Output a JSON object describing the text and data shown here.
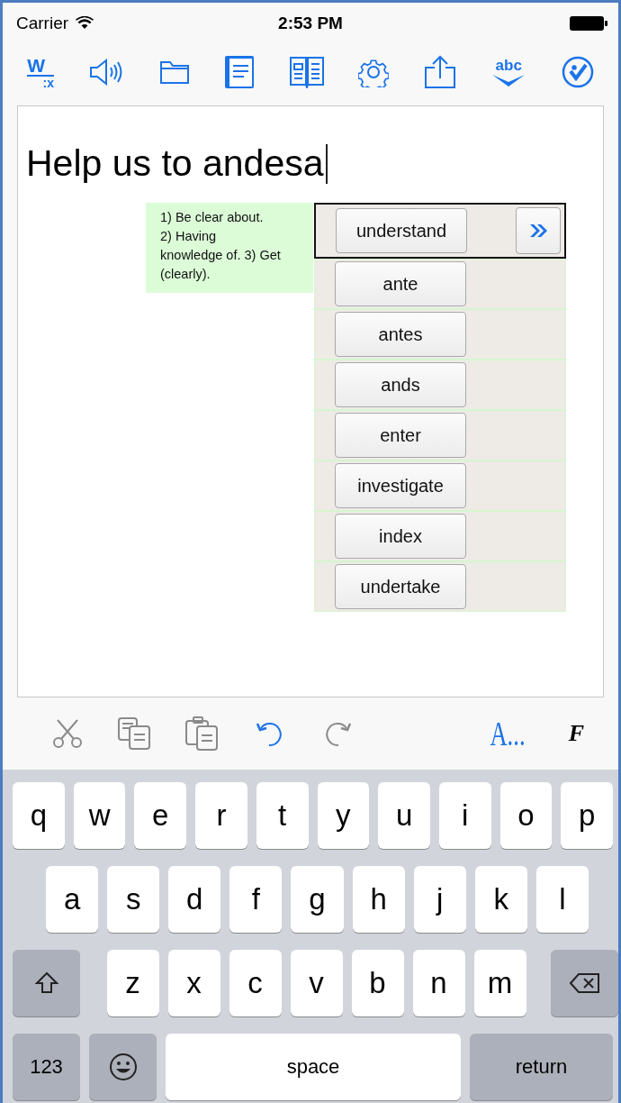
{
  "status_bar": {
    "carrier": "Carrier",
    "time": "2:53 PM"
  },
  "toolbar": [
    {
      "kind": "word-count",
      "label": "W",
      "sublabel": ":x"
    },
    {
      "kind": "speaker"
    },
    {
      "kind": "folder"
    },
    {
      "kind": "book"
    },
    {
      "kind": "open-book"
    },
    {
      "kind": "settings"
    },
    {
      "kind": "share"
    },
    {
      "kind": "spell-check",
      "label": "abc"
    },
    {
      "kind": "check-circle"
    }
  ],
  "editor": {
    "text": "Help us to andesa",
    "definition": "1) Be clear about.\n2) Having\nknowledge of. 3) Get\n(clearly).",
    "suggestions": [
      {
        "word": "understand",
        "selected": true
      },
      {
        "word": "ante",
        "selected": false
      },
      {
        "word": "antes",
        "selected": false
      },
      {
        "word": "ands",
        "selected": false
      },
      {
        "word": "enter",
        "selected": false
      },
      {
        "word": "investigate",
        "selected": false
      },
      {
        "word": "index",
        "selected": false
      },
      {
        "word": "undertake",
        "selected": false
      }
    ]
  },
  "edit_toolbar": [
    {
      "kind": "cut",
      "disabled": true
    },
    {
      "kind": "copy",
      "disabled": true
    },
    {
      "kind": "paste",
      "disabled": true
    },
    {
      "kind": "undo",
      "disabled": false
    },
    {
      "kind": "redo",
      "disabled": true
    },
    {
      "kind": "font",
      "label": "A...",
      "disabled": false
    },
    {
      "kind": "format",
      "label": "F",
      "disabled": false
    }
  ],
  "keyboard": [
    [
      {
        "kind": "letter",
        "label": "q"
      },
      {
        "kind": "letter",
        "label": "w"
      },
      {
        "kind": "letter",
        "label": "e"
      },
      {
        "kind": "letter",
        "label": "r"
      },
      {
        "kind": "letter",
        "label": "t"
      },
      {
        "kind": "letter",
        "label": "y"
      },
      {
        "kind": "letter",
        "label": "u"
      },
      {
        "kind": "letter",
        "label": "i"
      },
      {
        "kind": "letter",
        "label": "o"
      },
      {
        "kind": "letter",
        "label": "p"
      }
    ],
    [
      {
        "kind": "letter",
        "label": "a"
      },
      {
        "kind": "letter",
        "label": "s"
      },
      {
        "kind": "letter",
        "label": "d"
      },
      {
        "kind": "letter",
        "label": "f"
      },
      {
        "kind": "letter",
        "label": "g"
      },
      {
        "kind": "letter",
        "label": "h"
      },
      {
        "kind": "letter",
        "label": "j"
      },
      {
        "kind": "letter",
        "label": "k"
      },
      {
        "kind": "letter",
        "label": "l"
      }
    ],
    [
      {
        "kind": "shift"
      },
      {
        "kind": "letter",
        "label": "z"
      },
      {
        "kind": "letter",
        "label": "x"
      },
      {
        "kind": "letter",
        "label": "c"
      },
      {
        "kind": "letter",
        "label": "v"
      },
      {
        "kind": "letter",
        "label": "b"
      },
      {
        "kind": "letter",
        "label": "n"
      },
      {
        "kind": "letter",
        "label": "m"
      },
      {
        "kind": "delete"
      }
    ],
    [
      {
        "kind": "numbers",
        "label": "123"
      },
      {
        "kind": "emoji"
      },
      {
        "kind": "space",
        "label": "space"
      },
      {
        "kind": "return",
        "label": "return"
      }
    ]
  ]
}
